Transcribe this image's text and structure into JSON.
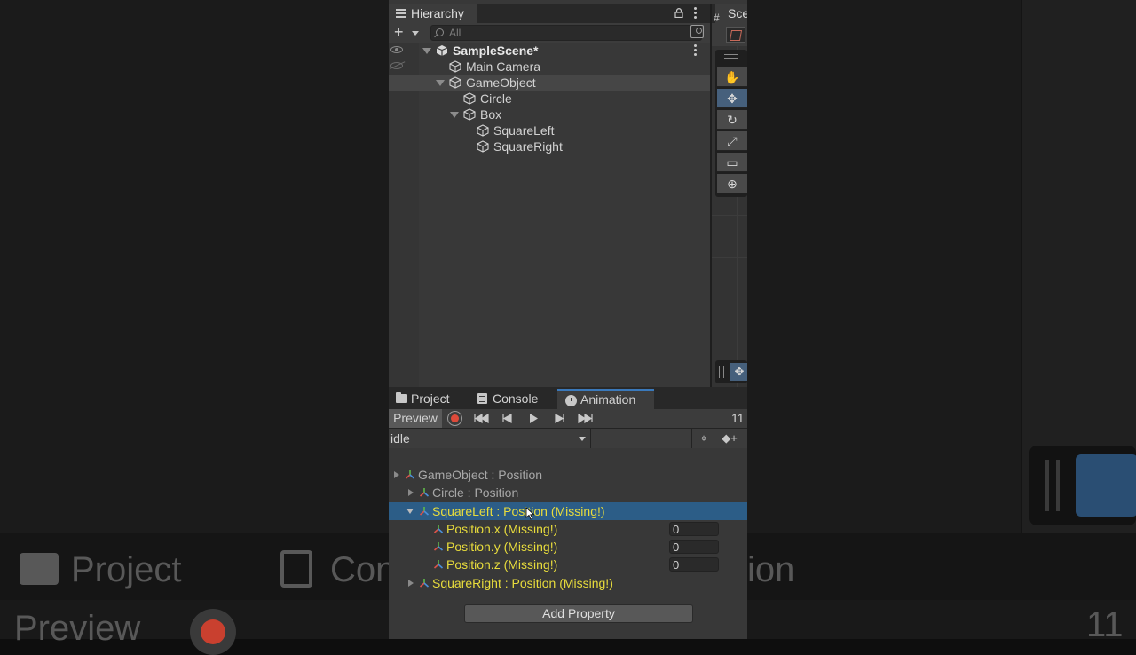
{
  "hierarchy": {
    "tab_label": "Hierarchy",
    "add_label": "+",
    "search_placeholder": "All",
    "scene_name": "SampleScene*",
    "items": [
      {
        "label": "Main Camera"
      },
      {
        "label": "GameObject"
      },
      {
        "label": "Circle"
      },
      {
        "label": "Box"
      },
      {
        "label": "SquareLeft"
      },
      {
        "label": "SquareRight"
      }
    ]
  },
  "scene": {
    "tab_label": "Scene"
  },
  "lower_tabs": [
    {
      "label": "Project"
    },
    {
      "label": "Console"
    },
    {
      "label": "Animation"
    }
  ],
  "animation": {
    "preview_label": "Preview",
    "frame_value": "11",
    "clip_name": "idle",
    "properties": [
      {
        "label": "GameObject : Position",
        "state": "normal"
      },
      {
        "label": "Circle : Position",
        "state": "normal"
      },
      {
        "label": "SquareLeft : Position (Missing!)",
        "state": "missing",
        "selected": true
      },
      {
        "label": "Position.x (Missing!)",
        "value": "0"
      },
      {
        "label": "Position.y (Missing!)",
        "value": "0"
      },
      {
        "label": "Position.z (Missing!)",
        "value": "0"
      },
      {
        "label": "SquareRight : Position (Missing!)",
        "state": "missing"
      }
    ],
    "add_property_label": "Add Property"
  },
  "background_echo": {
    "project": "Project",
    "console": "Con",
    "animation": "ion",
    "preview": "Preview",
    "frame": "11"
  },
  "colors": {
    "missing_text": "#e8dc3c",
    "selection": "#2c5d87",
    "record": "#dd4a3a",
    "active_tab_accent": "#3a79bb"
  }
}
